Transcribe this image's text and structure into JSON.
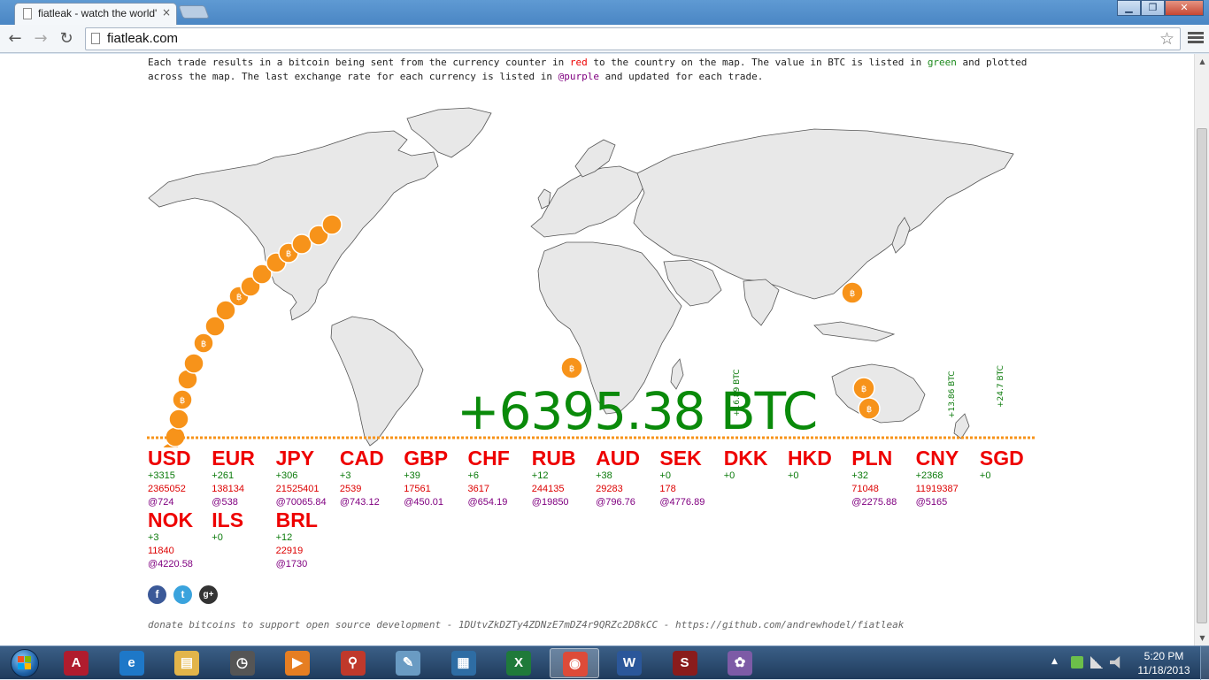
{
  "browser": {
    "tab_title": "fiatleak - watch the world'",
    "tab_close": "×",
    "url": "fiatleak.com",
    "back": "←",
    "forward": "→",
    "reload": "↻",
    "star": "☆",
    "win_min": "▁",
    "win_max": "❐",
    "win_close": "✕"
  },
  "intro": {
    "p1": "Each trade results in a bitcoin being sent from the currency counter in ",
    "red_word": "red",
    "p2": " to the country on the map. The value in BTC is listed in ",
    "green_word": "green",
    "p3": " and plotted across the map. The last exchange rate for each currency is listed in ",
    "purple_word": "@purple",
    "p4": " and updated for each trade."
  },
  "total_btc": "+6395.38 BTC",
  "vertical_labels": [
    {
      "text": "+16.89 BTC"
    },
    {
      "text": "+13.86 BTC"
    },
    {
      "text": "+24.7 BTC"
    }
  ],
  "currencies": [
    {
      "code": "USD",
      "delta": "+3315",
      "count": "2365052",
      "rate": "@724"
    },
    {
      "code": "EUR",
      "delta": "+261",
      "count": "138134",
      "rate": "@538"
    },
    {
      "code": "JPY",
      "delta": "+306",
      "count": "21525401",
      "rate": "@70065.84"
    },
    {
      "code": "CAD",
      "delta": "+3",
      "count": "2539",
      "rate": "@743.12"
    },
    {
      "code": "GBP",
      "delta": "+39",
      "count": "17561",
      "rate": "@450.01"
    },
    {
      "code": "CHF",
      "delta": "+6",
      "count": "3617",
      "rate": "@654.19"
    },
    {
      "code": "RUB",
      "delta": "+12",
      "count": "244135",
      "rate": "@19850"
    },
    {
      "code": "AUD",
      "delta": "+38",
      "count": "29283",
      "rate": "@796.76"
    },
    {
      "code": "SEK",
      "delta": "+0",
      "count": "178",
      "rate": "@4776.89"
    },
    {
      "code": "DKK",
      "delta": "+0",
      "count": "",
      "rate": ""
    },
    {
      "code": "HKD",
      "delta": "+0",
      "count": "",
      "rate": ""
    },
    {
      "code": "PLN",
      "delta": "+32",
      "count": "71048",
      "rate": "@2275.88"
    },
    {
      "code": "CNY",
      "delta": "+2368",
      "count": "11919387",
      "rate": "@5165"
    },
    {
      "code": "SGD",
      "delta": "+0",
      "count": "",
      "rate": ""
    },
    {
      "code": "NOK",
      "delta": "+3",
      "count": "11840",
      "rate": "@4220.58"
    },
    {
      "code": "ILS",
      "delta": "+0",
      "count": "",
      "rate": ""
    },
    {
      "code": "BRL",
      "delta": "+12",
      "count": "22919",
      "rate": "@1730"
    }
  ],
  "social": {
    "facebook": "f",
    "twitter": "t",
    "gplus": "g+"
  },
  "donate": "donate bitcoins to support open source development - 1DUtvZkDZTy4ZDNzE7mDZ4r9QRZc2D8kCC - https://github.com/andrewhodel/fiatleak",
  "taskbar": {
    "apps": [
      {
        "name": "access",
        "glyph": "A",
        "color": "#b01c2e"
      },
      {
        "name": "internet-explorer",
        "glyph": "e",
        "color": "#1e78c8"
      },
      {
        "name": "file-explorer",
        "glyph": "▤",
        "color": "#e3b54a"
      },
      {
        "name": "clock-app",
        "glyph": "◷",
        "color": "#555"
      },
      {
        "name": "media-player",
        "glyph": "▶",
        "color": "#e67e22"
      },
      {
        "name": "pushpin-app",
        "glyph": "⚲",
        "color": "#c0392b"
      },
      {
        "name": "notepad-app",
        "glyph": "✎",
        "color": "#6a9bc3"
      },
      {
        "name": "calculator-app",
        "glyph": "▦",
        "color": "#2e6da4"
      },
      {
        "name": "excel",
        "glyph": "X",
        "color": "#1f7a3a"
      },
      {
        "name": "chrome",
        "glyph": "◉",
        "color": "#dd4b39"
      },
      {
        "name": "word",
        "glyph": "W",
        "color": "#2b579a"
      },
      {
        "name": "s-plus",
        "glyph": "S",
        "color": "#8a1c1c"
      },
      {
        "name": "paint",
        "glyph": "✿",
        "color": "#7d5ba6"
      }
    ],
    "time": "5:20 PM",
    "date": "11/18/2013",
    "tray_arrow": "▲"
  }
}
